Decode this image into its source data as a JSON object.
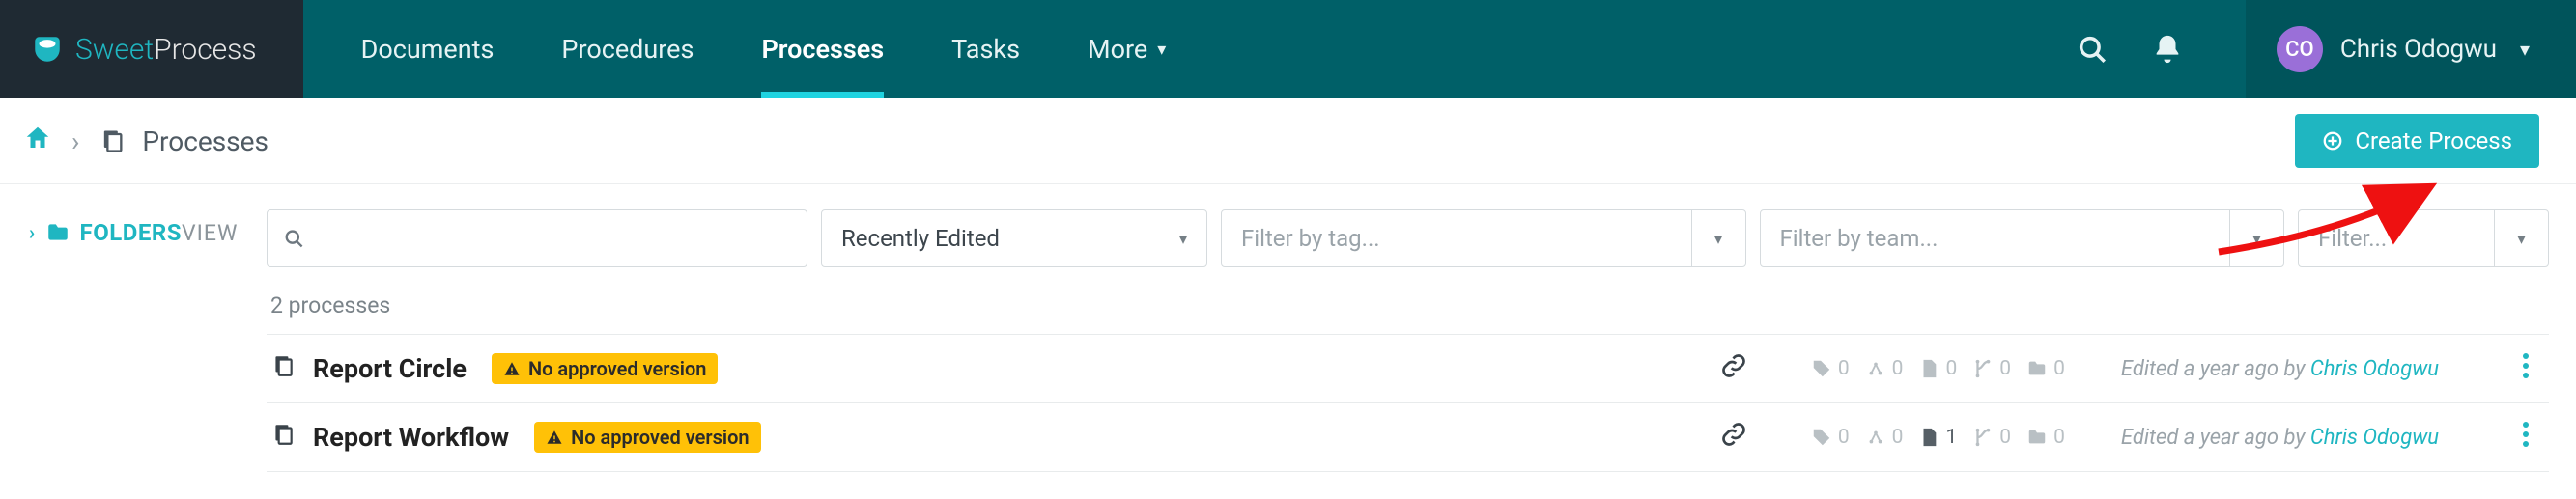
{
  "brand": {
    "part1": "Sweet",
    "part2": "Process"
  },
  "nav": {
    "items": [
      {
        "label": "Documents"
      },
      {
        "label": "Procedures"
      },
      {
        "label": "Processes"
      },
      {
        "label": "Tasks"
      },
      {
        "label": "More"
      }
    ],
    "active_index": 2
  },
  "user": {
    "initials": "CO",
    "name": "Chris Odogwu"
  },
  "breadcrumb": {
    "page_label": "Processes"
  },
  "create_button": {
    "label": "Create Process"
  },
  "sidebar": {
    "folders_label": "FOLDERS",
    "view_label": "VIEW"
  },
  "filters": {
    "search_placeholder": "",
    "sort": "Recently Edited",
    "tag_placeholder": "Filter by tag...",
    "team_placeholder": "Filter by team...",
    "filter_placeholder": "Filter..."
  },
  "list": {
    "count_label": "2 processes",
    "rows": [
      {
        "title": "Report Circle",
        "badge": "No approved version",
        "stats": {
          "tag": 0,
          "share": 0,
          "file": 0,
          "branch": 0,
          "folder": 0,
          "file_on": false
        },
        "edited_prefix": "Edited a year ago by ",
        "edited_user": "Chris Odogwu"
      },
      {
        "title": "Report Workflow",
        "badge": "No approved version",
        "stats": {
          "tag": 0,
          "share": 0,
          "file": 1,
          "branch": 0,
          "folder": 0,
          "file_on": true
        },
        "edited_prefix": "Edited a year ago by ",
        "edited_user": "Chris Odogwu"
      }
    ]
  }
}
